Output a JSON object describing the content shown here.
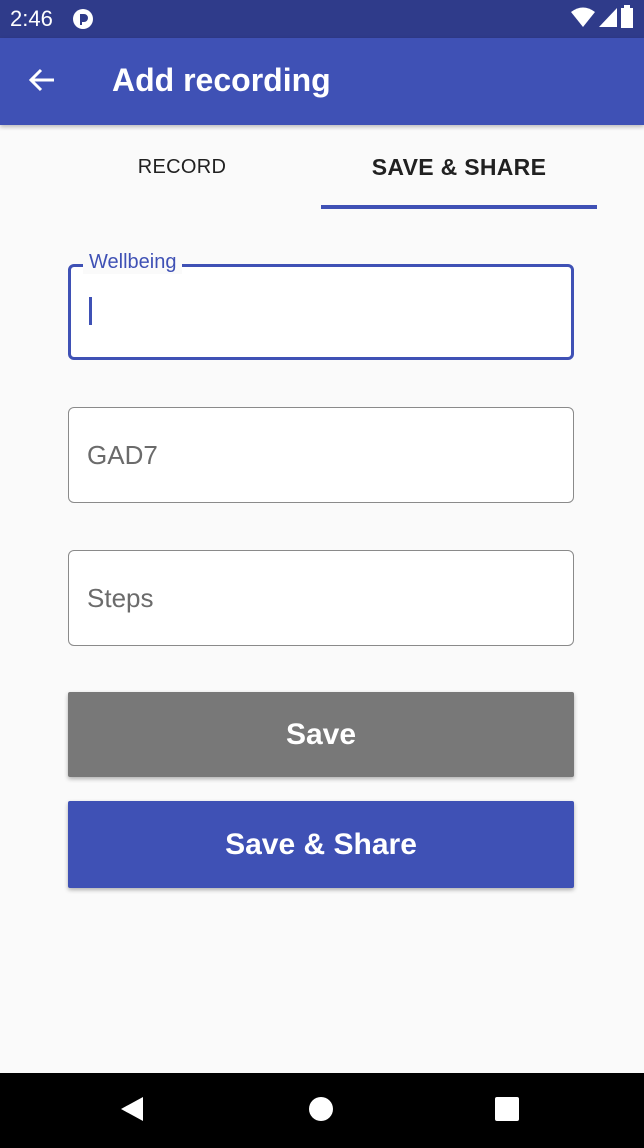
{
  "status_bar": {
    "time": "2:46"
  },
  "app_bar": {
    "title": "Add recording",
    "back_icon": "arrow-left-icon"
  },
  "tabs": [
    {
      "label": "RECORD",
      "selected": false
    },
    {
      "label": "SAVE & SHARE",
      "selected": true
    }
  ],
  "form": {
    "wellbeing": {
      "label": "Wellbeing",
      "value": ""
    },
    "gad7": {
      "placeholder": "GAD7",
      "value": ""
    },
    "steps": {
      "placeholder": "Steps",
      "value": ""
    }
  },
  "buttons": {
    "save_label": "Save",
    "save_share_label": "Save & Share"
  },
  "colors": {
    "primary": "#3f51b5",
    "status_bar": "#2f3b8a",
    "save_button": "#787878"
  },
  "nav_bar": {
    "icons": [
      "back-triangle-icon",
      "home-circle-icon",
      "recents-square-icon"
    ]
  }
}
